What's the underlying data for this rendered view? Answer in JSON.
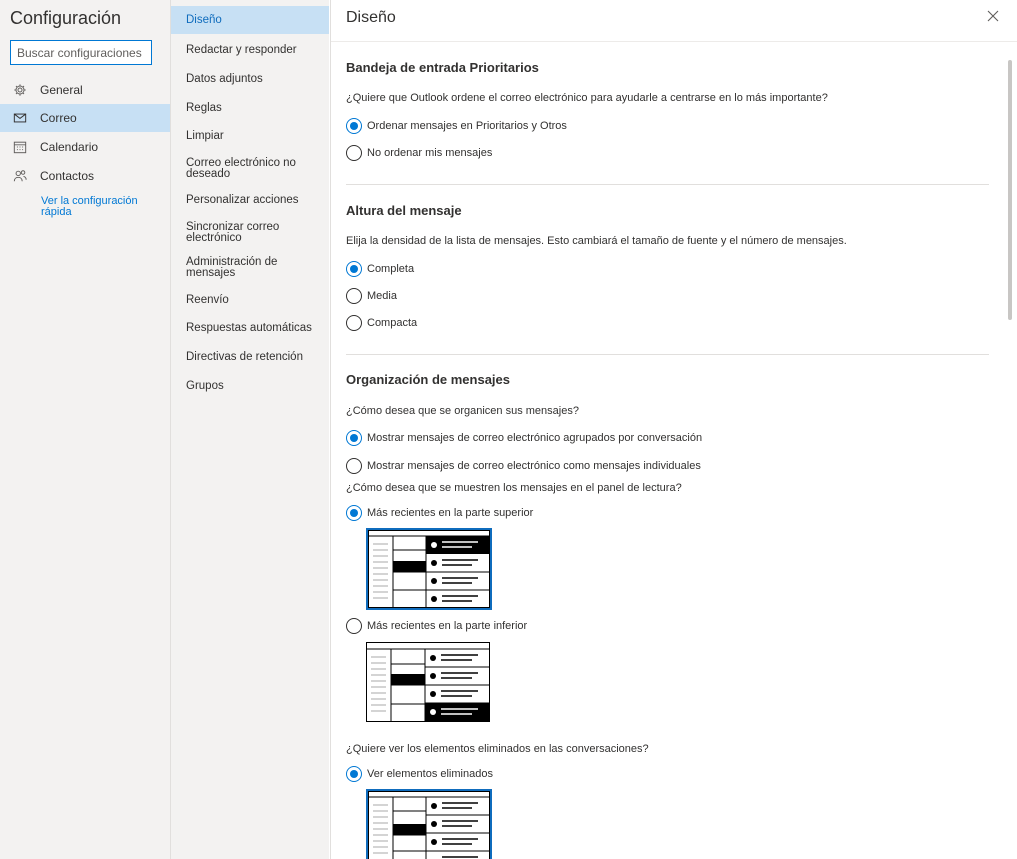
{
  "app": {
    "title": "Configuración"
  },
  "search": {
    "placeholder": "Buscar configuraciones"
  },
  "categories": [
    {
      "label": "General",
      "icon": "gear-icon"
    },
    {
      "label": "Correo",
      "icon": "mail-icon",
      "active": true
    },
    {
      "label": "Calendario",
      "icon": "calendar-icon"
    },
    {
      "label": "Contactos",
      "icon": "people-icon"
    }
  ],
  "quick_link": "Ver la configuración rápida",
  "subnav": [
    "Diseño",
    "Redactar y responder",
    "Datos adjuntos",
    "Reglas",
    "Limpiar",
    "Correo electrónico no deseado",
    "Personalizar acciones",
    "Sincronizar correo electrónico",
    "Administración de mensajes",
    "Reenvío",
    "Respuestas automáticas",
    "Directivas de retención",
    "Grupos"
  ],
  "panel": {
    "title": "Diseño",
    "close_icon": "close-icon",
    "focused": {
      "title": "Bandeja de entrada Prioritarios",
      "question": "¿Quiere que Outlook ordene el correo electrónico para ayudarle a centrarse en lo más importante?",
      "options": [
        {
          "label": "Ordenar mensajes en Prioritarios y Otros",
          "checked": true
        },
        {
          "label": "No ordenar mis mensajes",
          "checked": false
        }
      ]
    },
    "height": {
      "title": "Altura del mensaje",
      "question": "Elija la densidad de la lista de mensajes. Esto cambiará el tamaño de fuente y el número de mensajes.",
      "options": [
        {
          "label": "Completa",
          "checked": true
        },
        {
          "label": "Media",
          "checked": false
        },
        {
          "label": "Compacta",
          "checked": false
        }
      ]
    },
    "organization": {
      "title": "Organización de mensajes",
      "question": "¿Cómo desea que se organicen sus mensajes?",
      "options": [
        {
          "label": "Mostrar mensajes de correo electrónico agrupados por conversación",
          "checked": true
        },
        {
          "label": "Mostrar mensajes de correo electrónico como mensajes individuales",
          "checked": false
        }
      ],
      "reading_question": "¿Cómo desea que se muestren los mensajes en el panel de lectura?",
      "reading_options": [
        {
          "label": "Más recientes en la parte superior",
          "checked": true
        },
        {
          "label": "Más recientes en la parte inferior",
          "checked": false
        }
      ],
      "deleted_question": "¿Quiere ver los elementos eliminados en las conversaciones?",
      "deleted_options": [
        {
          "label": "Ver elementos eliminados",
          "checked": true
        }
      ]
    }
  },
  "colors": {
    "accent": "#0078d4",
    "active_bg": "#c7e0f4",
    "nav_bg": "#f3f2f1"
  }
}
